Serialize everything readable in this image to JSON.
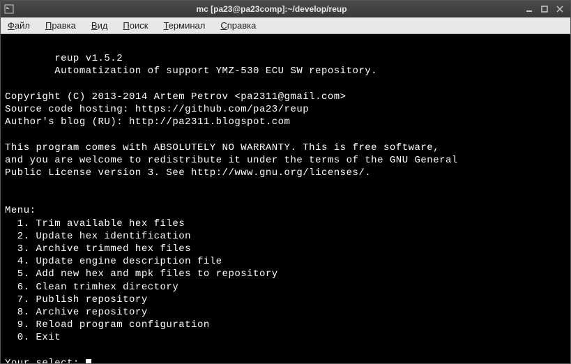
{
  "window": {
    "title": "mc [pa23@pa23comp]:~/develop/reup"
  },
  "menubar": {
    "items": [
      {
        "label": "Файл",
        "underline_index": 0
      },
      {
        "label": "Правка",
        "underline_index": 0
      },
      {
        "label": "Вид",
        "underline_index": 0
      },
      {
        "label": "Поиск",
        "underline_index": 0
      },
      {
        "label": "Терминал",
        "underline_index": 0
      },
      {
        "label": "Справка",
        "underline_index": 0
      }
    ]
  },
  "terminal": {
    "lines": [
      "",
      "        reup v1.5.2",
      "        Automatization of support YMZ-530 ECU SW repository.",
      "",
      "Copyright (C) 2013-2014 Artem Petrov <pa2311@gmail.com>",
      "Source code hosting: https://github.com/pa23/reup",
      "Author's blog (RU): http://pa2311.blogspot.com",
      "",
      "This program comes with ABSOLUTELY NO WARRANTY. This is free software,",
      "and you are welcome to redistribute it under the terms of the GNU General",
      "Public License version 3. See http://www.gnu.org/licenses/.",
      "",
      "",
      "Menu:",
      "  1. Trim available hex files",
      "  2. Update hex identification",
      "  3. Archive trimmed hex files",
      "  4. Update engine description file",
      "  5. Add new hex and mpk files to repository",
      "  6. Clean trimhex directory",
      "  7. Publish repository",
      "  8. Archive repository",
      "  9. Reload program configuration",
      "  0. Exit",
      "",
      "Your select: "
    ]
  }
}
